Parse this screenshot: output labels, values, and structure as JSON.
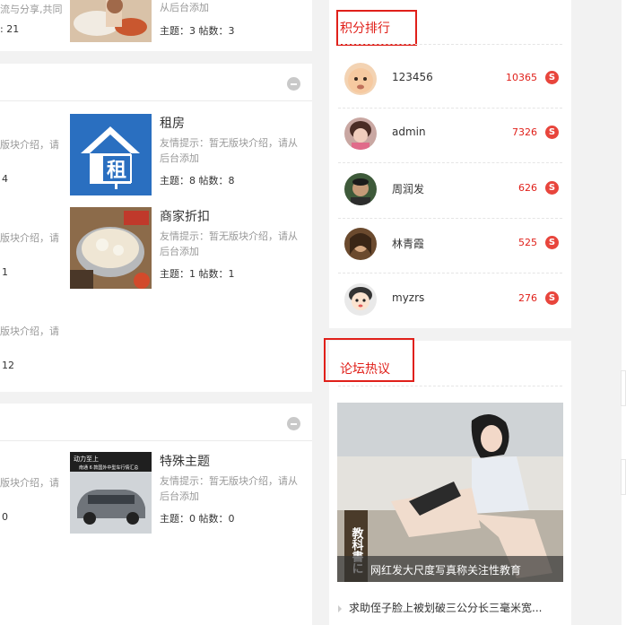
{
  "left": {
    "top_fragment": {
      "desc_cut": "流与分享,共同",
      "num_cut": ": 21",
      "forum": {
        "desc": "从后台添加",
        "stats": "主题：3   帖数：3"
      }
    },
    "section2": {
      "cut_desc_1": "版块介绍，请",
      "cut_num_1": "4",
      "cut_desc_2": "版块介绍，请",
      "cut_num_2": "1",
      "cut_desc_3": "版块介绍，请",
      "cut_num_3": "12",
      "forums": [
        {
          "name": "租房",
          "desc": "友情提示：暂无版块介绍，请从后台添加",
          "stats": "主题：8   帖数：8"
        },
        {
          "name": "商家折扣",
          "desc": "友情提示：暂无版块介绍，请从后台添加",
          "stats": "主题：1   帖数：1"
        }
      ]
    },
    "section3": {
      "cut_desc_1": "版块介绍，请",
      "cut_num_1": "0",
      "forums": [
        {
          "name": "特殊主题",
          "desc": "友情提示：暂无版块介绍，请从后台添加",
          "stats": "主题：0   帖数：0"
        }
      ],
      "car_banner_top": "动力至上",
      "car_banner_sub": "南通 6 款国外中型车行情汇总"
    }
  },
  "ranking": {
    "title": "积分排行",
    "users": [
      {
        "name": "123456",
        "score": "10365",
        "coin": "S"
      },
      {
        "name": "admin",
        "score": "7326",
        "coin": "S"
      },
      {
        "name": "周润发",
        "score": "626",
        "coin": "S"
      },
      {
        "name": "林青霞",
        "score": "525",
        "coin": "S"
      },
      {
        "name": "myzrs",
        "score": "276",
        "coin": "S"
      }
    ]
  },
  "hot": {
    "title": "论坛热议",
    "caption": "网红发大尺度写真称关注性教育",
    "item": "求助侄子脸上被划破三公分长三毫米宽...",
    "book_text": "教科書に"
  },
  "colors": {
    "accent": "#e0201a",
    "coin": "#e8453c",
    "house_blue": "#2a6fc0"
  }
}
